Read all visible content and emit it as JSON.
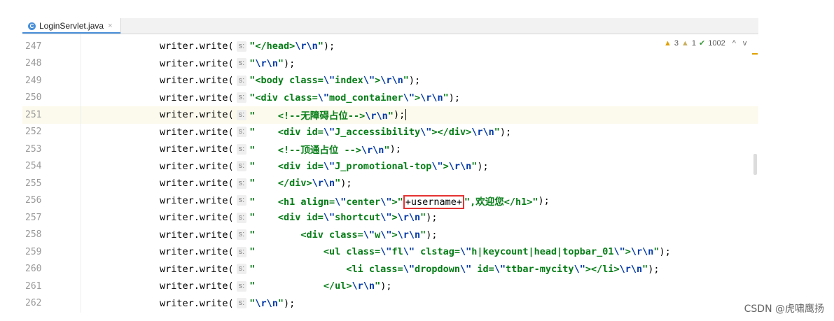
{
  "tab": {
    "icon": "java-class-icon",
    "label": "LoginServlet.java",
    "close": "×"
  },
  "inspections": {
    "warnings": "3",
    "weak_warnings": "1",
    "typos": "1002",
    "up": "^",
    "down": "v"
  },
  "param_hint": "s:",
  "watermark": "CSDN @虎啸鹰扬",
  "lines": [
    {
      "n": "247",
      "arg": "\"</head>\\r\\n\""
    },
    {
      "n": "248",
      "arg": "\"\\r\\n\""
    },
    {
      "n": "249",
      "arg": "\"<body class=\\\"index\\\">\\r\\n\""
    },
    {
      "n": "250",
      "arg": "\"<div class=\\\"mod_container\\\">\\r\\n\""
    },
    {
      "n": "251",
      "arg": "\"    <!--无障碍占位-->\\r\\n\""
    },
    {
      "n": "252",
      "arg": "\"    <div id=\\\"J_accessibility\\\"></div>\\r\\n\""
    },
    {
      "n": "253",
      "arg": "\"    <!--顶通占位 -->\\r\\n\""
    },
    {
      "n": "254",
      "arg": "\"    <div id=\\\"J_promotional-top\\\">\\r\\n\""
    },
    {
      "n": "255",
      "arg": "\"    </div>\\r\\n\""
    },
    {
      "n": "256",
      "arg_pre": "\"    <h1 align=\\\"center\\\">\"",
      "arg_box": "+username+",
      "arg_post": "\",欢迎您</h1>\""
    },
    {
      "n": "257",
      "arg": "\"    <div id=\\\"shortcut\\\">\\r\\n\""
    },
    {
      "n": "258",
      "arg": "\"        <div class=\\\"w\\\">\\r\\n\""
    },
    {
      "n": "259",
      "arg": "\"            <ul class=\\\"fl\\\" clstag=\\\"h|keycount|head|topbar_01\\\">\\r\\n\""
    },
    {
      "n": "260",
      "arg": "\"                <li class=\\\"dropdown\\\" id=\\\"ttbar-mycity\\\"></li>\\r\\n\""
    },
    {
      "n": "261",
      "arg": "\"            </ul>\\r\\n\""
    },
    {
      "n": "262",
      "arg": "\"\\r\\n\""
    }
  ],
  "call_prefix": "writer.write(",
  "call_suffix": ");"
}
